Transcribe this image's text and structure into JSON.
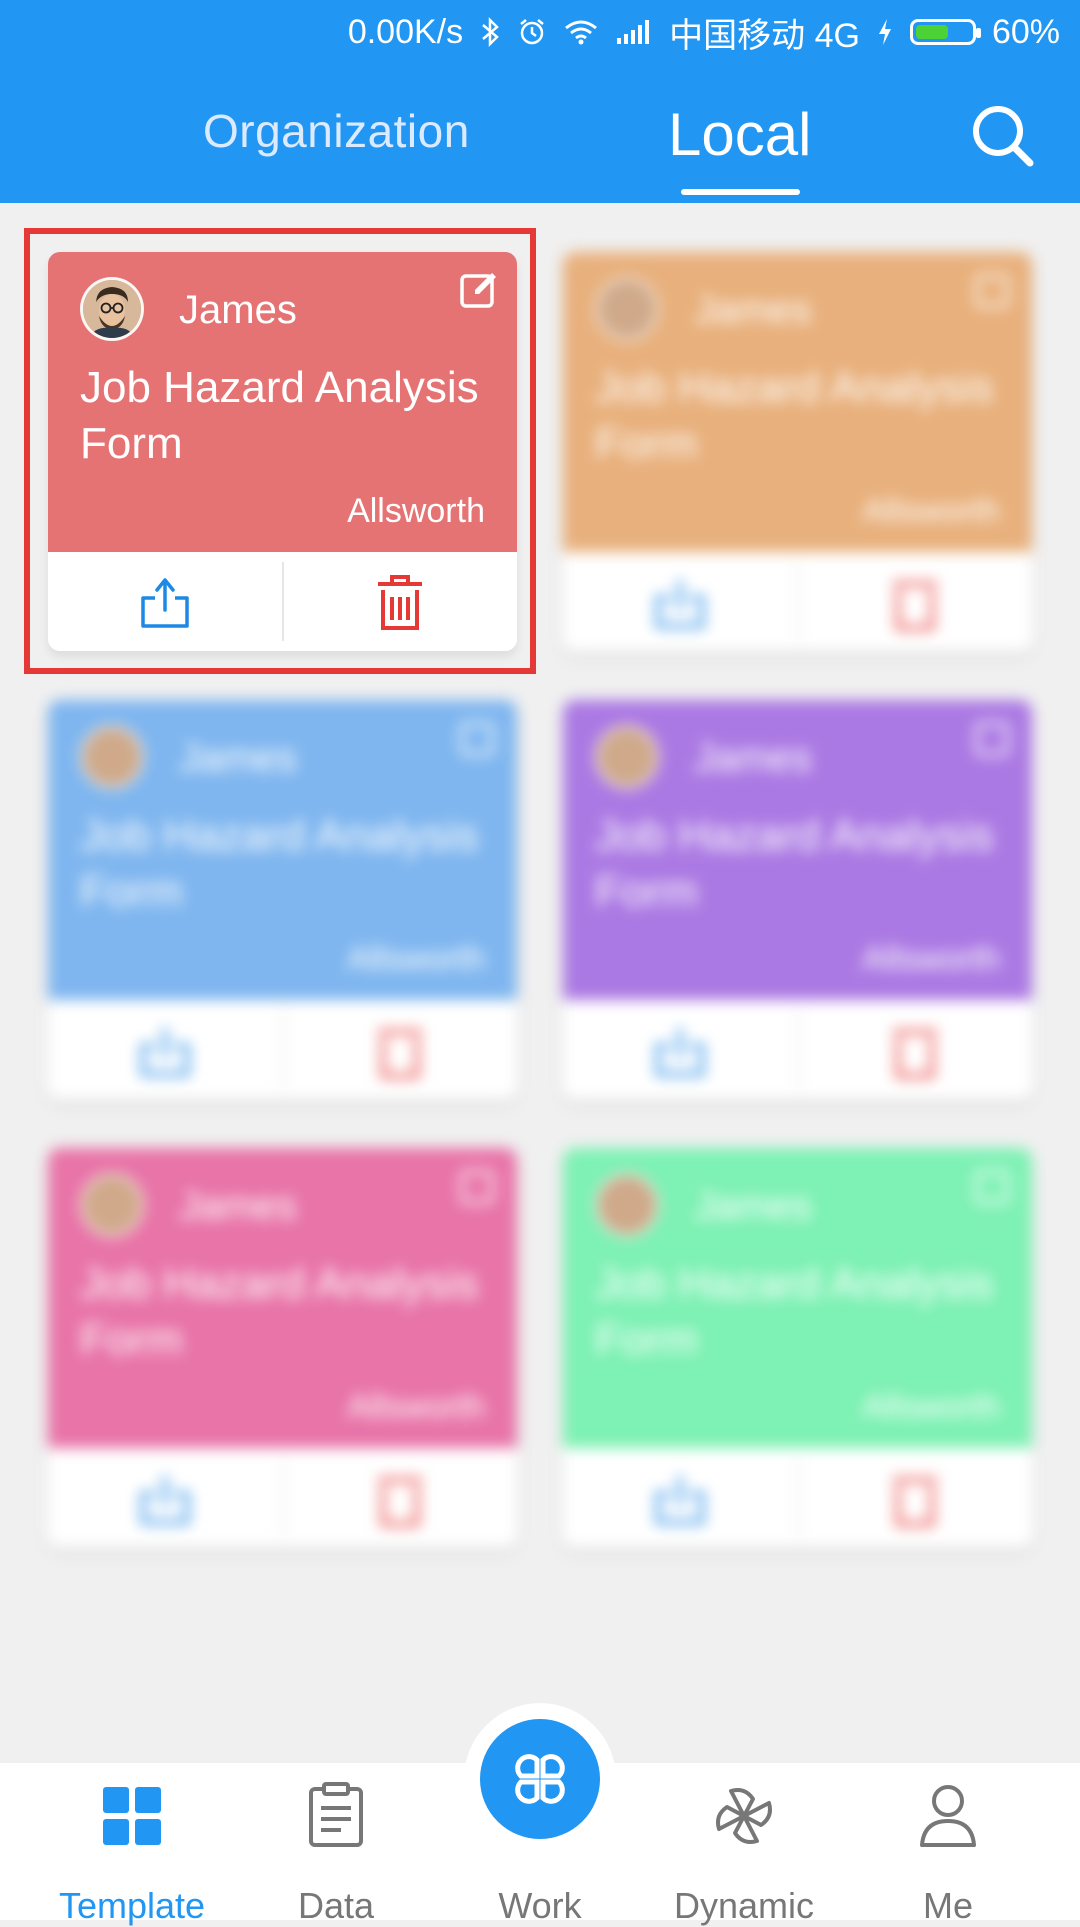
{
  "status_bar": {
    "speed": "0.00K/s",
    "carrier": "中国移动 4G",
    "battery": "60%",
    "battery_level": 0.6
  },
  "tabs": [
    {
      "label": "Organization",
      "active": false
    },
    {
      "label": "Local",
      "active": true
    }
  ],
  "cards": [
    {
      "author": "James",
      "title": "Job Hazard Analysis Form",
      "company": "Allsworth",
      "color": "#e57373",
      "blurred": false
    },
    {
      "author": "James",
      "title": "Job Hazard Analysis Form",
      "company": "Allsworth",
      "color": "#e8b07c",
      "blurred": true
    },
    {
      "author": "James",
      "title": "Job Hazard Analysis Form",
      "company": "Allsworth",
      "color": "#7fb6ef",
      "blurred": true
    },
    {
      "author": "James",
      "title": "Job Hazard Analysis Form",
      "company": "Allsworth",
      "color": "#ab79e3",
      "blurred": true
    },
    {
      "author": "James",
      "title": "Job Hazard Analysis Form",
      "company": "Allsworth",
      "color": "#e874a8",
      "blurred": true
    },
    {
      "author": "James",
      "title": "Job Hazard Analysis Form",
      "company": "Allsworth",
      "color": "#7ef1b4",
      "blurred": true
    }
  ],
  "bottom_nav": [
    {
      "label": "Template",
      "icon": "template-icon",
      "active": true
    },
    {
      "label": "Data",
      "icon": "clipboard-icon",
      "active": false
    },
    {
      "label": "Work",
      "icon": "work-icon",
      "active": false
    },
    {
      "label": "Dynamic",
      "icon": "pinwheel-icon",
      "active": false
    },
    {
      "label": "Me",
      "icon": "person-icon",
      "active": false
    }
  ],
  "colors": {
    "primary": "#2196f3",
    "highlight": "#e53935",
    "delete": "#e53935",
    "share": "#1e88e5"
  }
}
